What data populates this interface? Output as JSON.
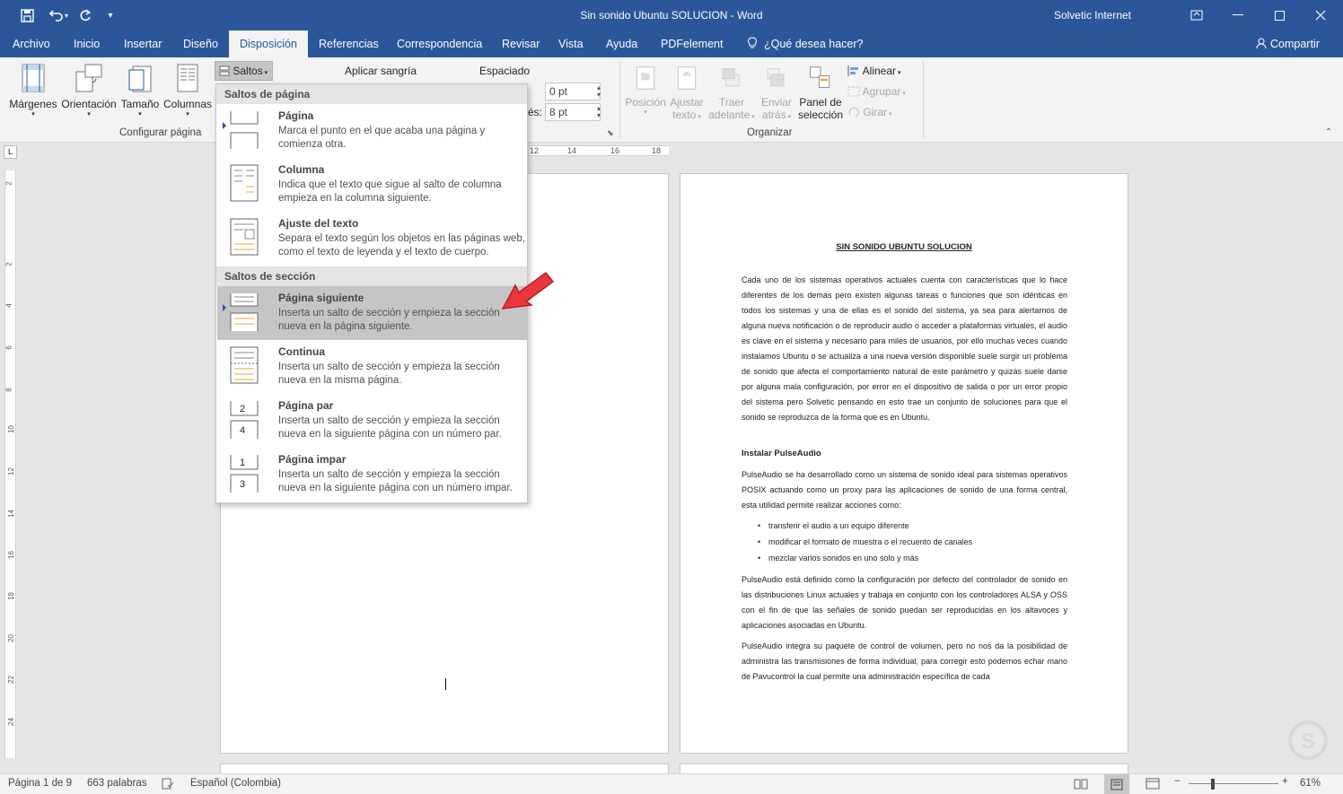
{
  "window": {
    "title": "Sin sonido Ubuntu SOLUCION  -  Word",
    "user": "Solvetic Internet"
  },
  "tabs": [
    "Archivo",
    "Inicio",
    "Insertar",
    "Diseño",
    "Disposición",
    "Referencias",
    "Correspondencia",
    "Revisar",
    "Vista",
    "Ayuda",
    "PDFelement",
    "¿Qué desea hacer?"
  ],
  "share_label": "Compartir",
  "ribbon": {
    "margenes": "Márgenes",
    "orientacion": "Orientación",
    "tamano": "Tamaño",
    "columnas": "Columnas",
    "saltos": "Saltos",
    "aplicar_sangria": "Aplicar sangría",
    "espaciado": "Espaciado",
    "espaciado_antes": "0 pt",
    "espaciado_despues": "8 pt",
    "despues_label": "és:",
    "configurar_pagina": "Configurar página",
    "posicion": [
      "Posición"
    ],
    "ajustar_texto": [
      "Ajustar",
      "texto"
    ],
    "traer_adelante": [
      "Traer",
      "adelante"
    ],
    "enviar_atras": [
      "Enviar",
      "atrás"
    ],
    "panel_seleccion": [
      "Panel de",
      "selección"
    ],
    "alinear": "Alinear",
    "agrupar": "Agrupar",
    "girar": "Girar",
    "organizar": "Organizar"
  },
  "ruler": [
    "12",
    "14",
    "16",
    "18"
  ],
  "vruler": [
    "2",
    "2",
    "4",
    "6",
    "8",
    "10",
    "12",
    "14",
    "16",
    "18",
    "20",
    "22",
    "24"
  ],
  "menu": {
    "section1": "Saltos de página",
    "section2": "Saltos de sección",
    "items": [
      {
        "title": "Página",
        "desc": "Marca el punto en el que acaba una página y comienza otra."
      },
      {
        "title": "Columna",
        "desc": "Indica que el texto que sigue al salto de columna empieza en la columna siguiente."
      },
      {
        "title": "Ajuste del texto",
        "desc": "Separa el texto según los objetos en las páginas web, como el texto de leyenda y el texto de cuerpo."
      },
      {
        "title": "Página siguiente",
        "desc": "Inserta un salto de sección y empieza la sección nueva en la página siguiente."
      },
      {
        "title": "Continua",
        "desc": "Inserta un salto de sección y empieza la sección nueva en la misma página."
      },
      {
        "title": "Página par",
        "desc": "Inserta un salto de sección y empieza la sección nueva en la siguiente página con un número par."
      },
      {
        "title": "Página impar",
        "desc": "Inserta un salto de sección y empieza la sección nueva en la siguiente página con un número impar."
      }
    ]
  },
  "document": {
    "title": "SIN SONIDO UBUNTU SOLUCION",
    "p1": "Cada uno de los sistemas operativos actuales cuenta con características que lo hace diferentes de los demás pero existen algunas tareas o funciones que son idénticas en todos los sistemas y una de ellas es el sonido del sistema, ya sea para alertarnos de alguna nueva notificación o de reproducir audio o acceder a plataformas virtuales, el audio es clave en el sistema y necesario para miles de usuarios, por ello muchas veces cuando instalamos Ubuntu o se actualiza a una nueva versión disponible suele surgir un problema de sonido que afecta el comportamiento natural de este parámetro y quizás suele darse por alguna mala configuración, por error en el dispositivo de salida o por un error propio del sistema pero Solvetic pensando en esto trae un conjunto de soluciones para que el sonido se reproduzca de la forma que es en Ubuntu.",
    "h1": "Instalar PulseAudio",
    "p2": "PulseAudio se ha desarrollado como un sistema de sonido ideal para sistemas operativos POSIX actuando como un proxy para las aplicaciones de sonido de una forma central, esta utilidad permite realizar acciones como:",
    "bullets": [
      "transferir el audio a un equipo diferente",
      "modificar el formato de muestra o el recuento de canales",
      "mezclar varios sonidos en uno solo y más"
    ],
    "p3": "PulseAudio está definido como la configuración por defecto del controlador de sonido en las distribuciones Linux actuales y trabaja en conjunto con los controladores ALSA y OSS con el fin de que las señales de sonido puedan ser reproducidas en los altavoces y aplicaciones asociadas en Ubuntu.",
    "p4": "PulseAudio integra su paquete de control de volumen, pero no nos da la posibilidad de  administra las transmisiones de forma individual, para corregir esto podemos echar mano de Pavucontrol la cual permite una administración específica de cada"
  },
  "status": {
    "page": "Página 1 de 9",
    "words": "663 palabras",
    "language": "Español (Colombia)",
    "zoom": "61%"
  },
  "colors": {
    "accent": "#2b579a",
    "arrow": "#e8373d"
  }
}
